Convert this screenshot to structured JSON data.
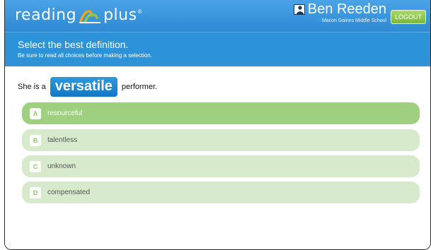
{
  "app": {
    "brand_left": "reading",
    "brand_right": "plus",
    "brand_mark": "®"
  },
  "user": {
    "name": "Ben Reeden",
    "school": "Macon Gaines Middle School",
    "logout_label": "LOGOUT"
  },
  "instructions": {
    "title": "Select the best definition.",
    "subtitle": "Be sure to read all choices before making a selection."
  },
  "question": {
    "prefix": "She is a",
    "word": "versatile",
    "suffix": "performer."
  },
  "choices": [
    {
      "letter": "A",
      "text": "resourceful",
      "selected": true
    },
    {
      "letter": "B",
      "text": "talentless",
      "selected": false
    },
    {
      "letter": "C",
      "text": "unknown",
      "selected": false
    },
    {
      "letter": "D",
      "text": "compensated",
      "selected": false
    }
  ],
  "colors": {
    "top_bar": "#3b98de",
    "header_panel": "#2d93d8",
    "selected_choice": "#9fd07f",
    "choice": "#d7ebcc",
    "logout": "#8cc84b",
    "word_pill": "#1f8ad4"
  }
}
